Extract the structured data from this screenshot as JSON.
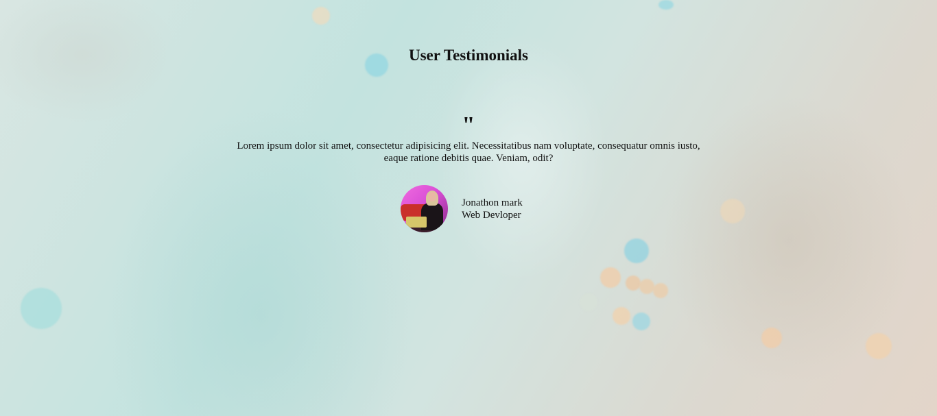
{
  "page": {
    "title": "User Testimonials"
  },
  "testimonial": {
    "quote_mark": "\"",
    "text": "Lorem ipsum dolor sit amet, consectetur adipisicing elit. Necessitatibus nam voluptate, consequatur omnis iusto, eaque ratione debitis quae. Veniam, odit?",
    "author_name": "Jonathon mark",
    "author_role": "Web Devloper"
  }
}
